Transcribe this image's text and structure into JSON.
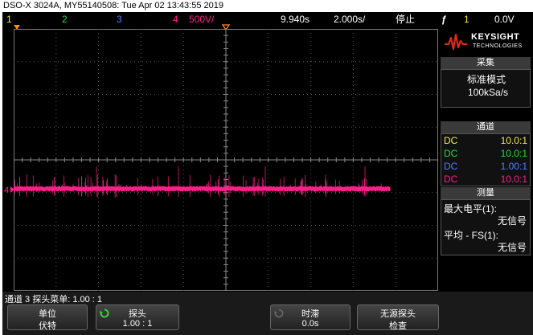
{
  "title_bar": "DSO-X 3024A, MY55140508: Tue Apr 02 13:43:55 2019",
  "top_bar": {
    "ch1": "1",
    "ch2": "2",
    "ch3": "3",
    "ch4": "4",
    "volts_div": "500V/",
    "delay": "9.940s",
    "time_div": "2.000s/",
    "run_state": "停止",
    "trigger_level": "0.0V"
  },
  "colors": {
    "ch1": "#f6e94a",
    "ch2": "#2bd641",
    "ch3": "#4f7dff",
    "ch4": "#ff1e8c",
    "background": "#000000"
  },
  "sidebar": {
    "brand": "KEYSIGHT",
    "brand_sub": "TECHNOLOGIES",
    "acquisition_header": "采集",
    "acq_mode": "标准模式",
    "sample_rate": "100kSa/s",
    "channels_header": "通道",
    "channels": [
      {
        "coupling": "DC",
        "probe": "10.0:1"
      },
      {
        "coupling": "DC",
        "probe": "10.0:1"
      },
      {
        "coupling": "DC",
        "probe": "1.00:1"
      },
      {
        "coupling": "DC",
        "probe": "10.0:1"
      }
    ],
    "measure_header": "测量",
    "measurements": [
      {
        "label": "最大电平(1):",
        "value": "无信号"
      },
      {
        "label": "平均 - FS(1):",
        "value": "无信号"
      }
    ]
  },
  "status_line": "通道 3 探头菜单: 1.00 : 1",
  "softkeys": [
    {
      "line1": "单位",
      "line2": "伏特"
    },
    {
      "line1": "探头",
      "line2": "1.00 : 1"
    },
    {
      "line1": "时滞",
      "line2": "0.0s"
    },
    {
      "line1": "无源探头",
      "line2": "检查"
    }
  ]
}
